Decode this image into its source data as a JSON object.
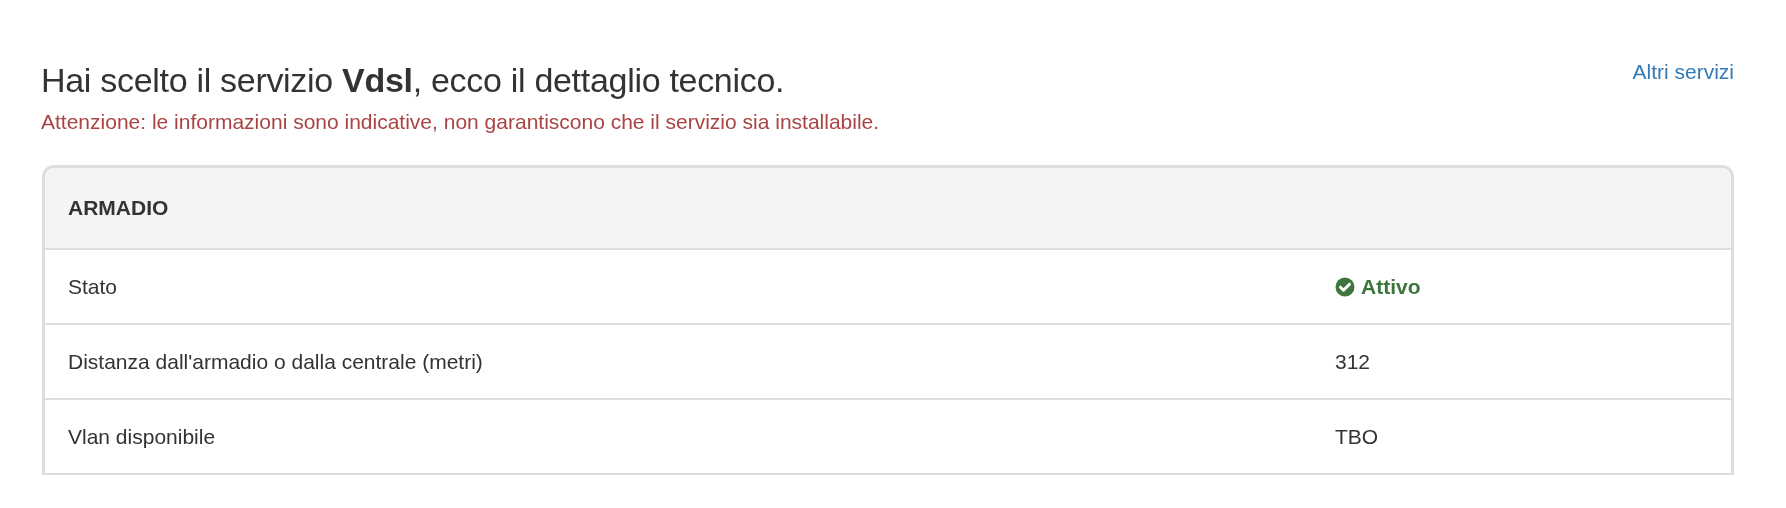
{
  "heading": {
    "text": "Hai scelto il servizio **Vdsl**, ecco il dettaglio tecnico."
  },
  "link": "Altri servizi",
  "warning": "Attenzione: le informazioni sono indicative, non garantiscono che il servizio sia installabile.",
  "panel": {
    "title": "ARMADIO",
    "rows": [
      {
        "label": "Stato",
        "value": "Attivo",
        "kind": "status"
      },
      {
        "label": "Distanza dall'armadio o dalla centrale (metri)",
        "value": "312",
        "kind": "text"
      },
      {
        "label": "Vlan disponibile",
        "value": "TBO",
        "kind": "text"
      }
    ]
  }
}
